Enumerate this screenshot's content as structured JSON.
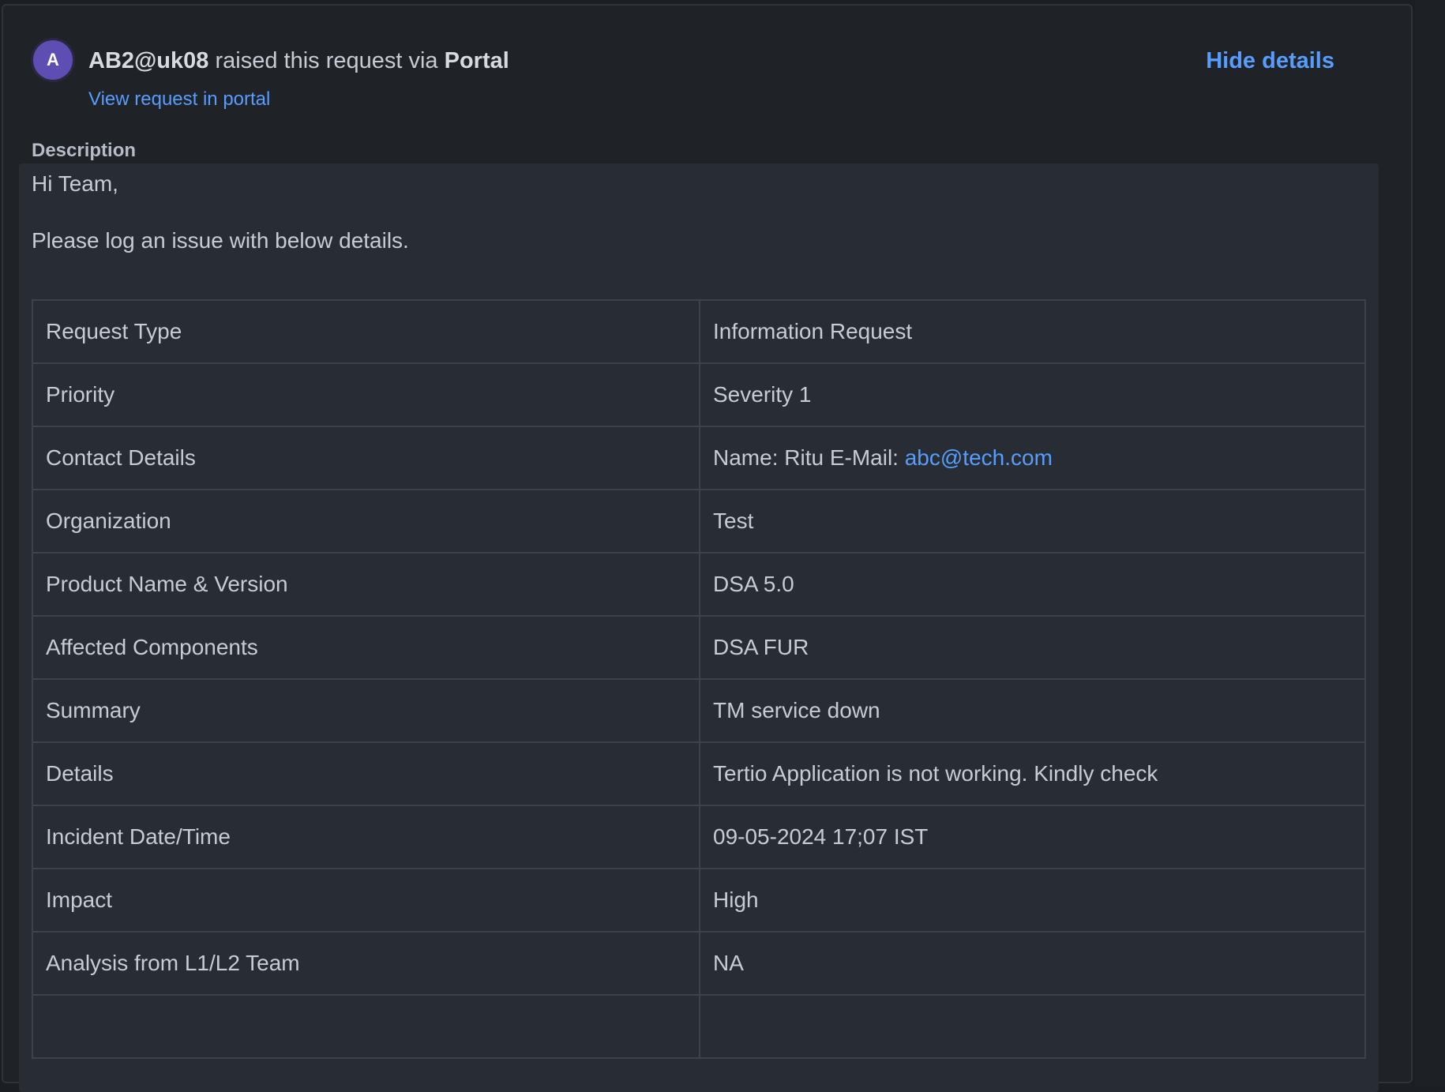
{
  "header": {
    "avatar_initial": "A",
    "user": "AB2@uk08",
    "action_text": "raised this request via",
    "channel": "Portal",
    "portal_link": "View request in portal",
    "hide_details": "Hide details"
  },
  "description": {
    "label": "Description",
    "greeting": "Hi Team,",
    "intro": "Please log an issue with below details.",
    "rows": [
      {
        "key": "Request Type",
        "value": "Information Request"
      },
      {
        "key": "Priority",
        "value": "Severity 1"
      },
      {
        "key": "Contact Details",
        "value": "Name: Ritu E-Mail:",
        "email": "abc@tech.com"
      },
      {
        "key": "Organization",
        "value": "Test"
      },
      {
        "key": "Product Name & Version",
        "value": "DSA 5.0"
      },
      {
        "key": "Affected Components",
        "value": "DSA FUR"
      },
      {
        "key": "Summary",
        "value": "TM service down"
      },
      {
        "key": "Details",
        "value": "Tertio Application is not working. Kindly check"
      },
      {
        "key": "Incident Date/Time",
        "value": "09-05-2024 17;07 IST"
      },
      {
        "key": "Impact",
        "value": "High"
      },
      {
        "key": "Analysis from L1/L2 Team",
        "value": "NA"
      },
      {
        "key": "",
        "value": ""
      }
    ]
  },
  "colors": {
    "background": "#1f2227",
    "description_box": "#282c33",
    "link": "#579dff",
    "avatar": "#5e4db2"
  }
}
